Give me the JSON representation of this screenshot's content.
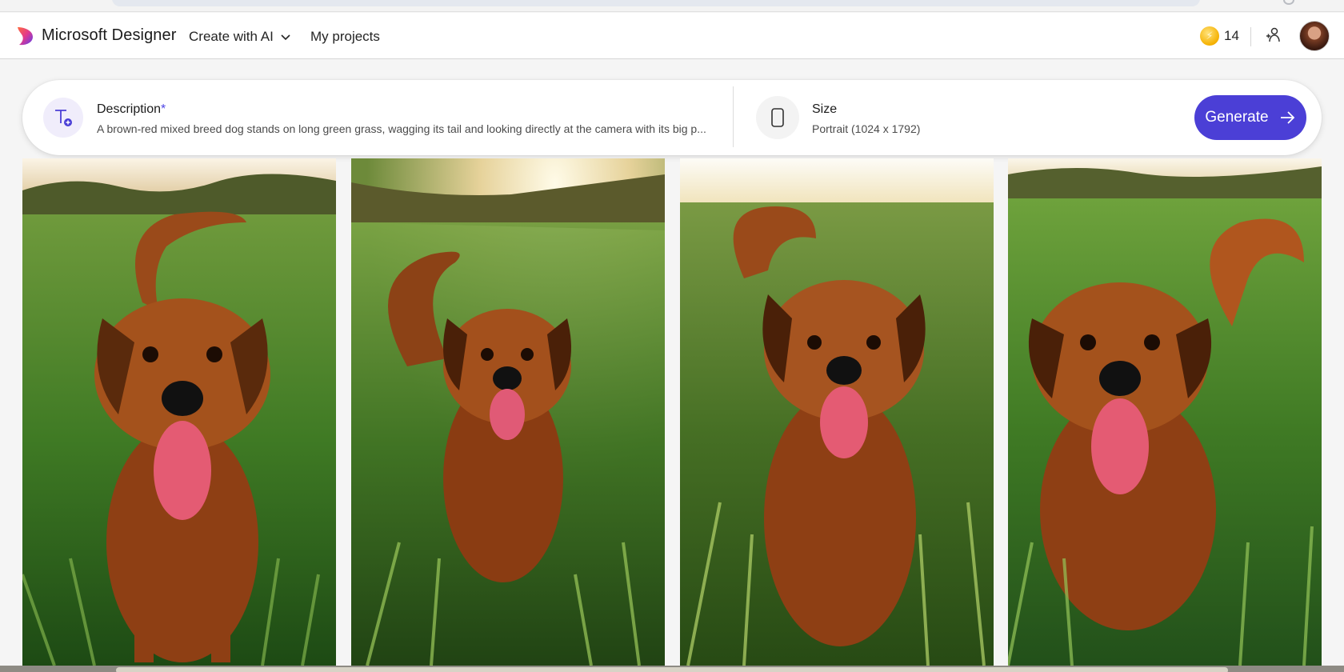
{
  "app": {
    "brand": "Microsoft Designer"
  },
  "nav": {
    "create_label": "Create with AI",
    "projects_label": "My projects"
  },
  "header": {
    "coin_count": "14"
  },
  "prompt": {
    "description_label": "Description",
    "required_mark": "*",
    "description_text": "A brown-red mixed breed dog stands on long green grass, wagging its tail and looking directly at the camera with its big p...",
    "size_label": "Size",
    "size_value": "Portrait (1024 x 1792)",
    "generate_label": "Generate"
  },
  "results": {
    "images": [
      {
        "subject": "brown-red dog in grass, tongue out",
        "icon": "generated-image"
      },
      {
        "subject": "brown-red dog in grass, backlit",
        "icon": "generated-image"
      },
      {
        "subject": "brown-red dog in tall grass, sunset",
        "icon": "generated-image"
      },
      {
        "subject": "brown-red dog in meadow, tail up",
        "icon": "generated-image"
      }
    ]
  },
  "colors": {
    "accent": "#4b3fd6",
    "coin": "#f5b100",
    "grass": "#3f7a24",
    "dog": "#9a4a1a"
  }
}
